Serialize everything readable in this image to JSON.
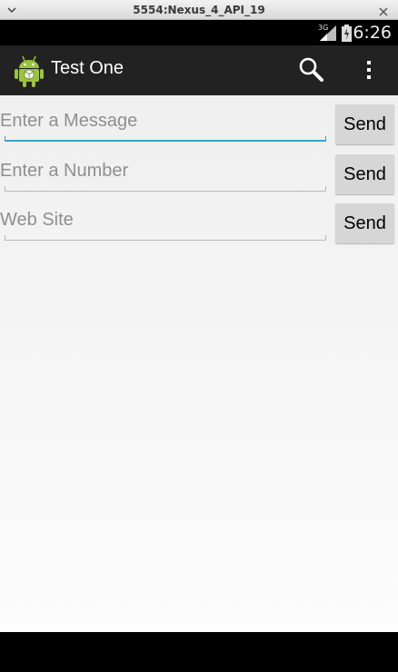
{
  "window": {
    "title": "5554:Nexus_4_API_19"
  },
  "status_bar": {
    "network_type": "3G",
    "time": "6:26"
  },
  "action_bar": {
    "title": "Test One",
    "icons": [
      "android-app-icon",
      "search-icon",
      "overflow-menu-icon"
    ]
  },
  "rows": [
    {
      "placeholder": "Enter a Message",
      "value": "",
      "focused": true,
      "button_label": "Send"
    },
    {
      "placeholder": "Enter a Number",
      "value": "",
      "focused": false,
      "button_label": "Send"
    },
    {
      "placeholder": "Web Site",
      "value": "",
      "focused": false,
      "button_label": "Send"
    }
  ],
  "colors": {
    "accent": "#33a5cf",
    "action_bar": "#222222",
    "button": "#d6d6d6"
  }
}
